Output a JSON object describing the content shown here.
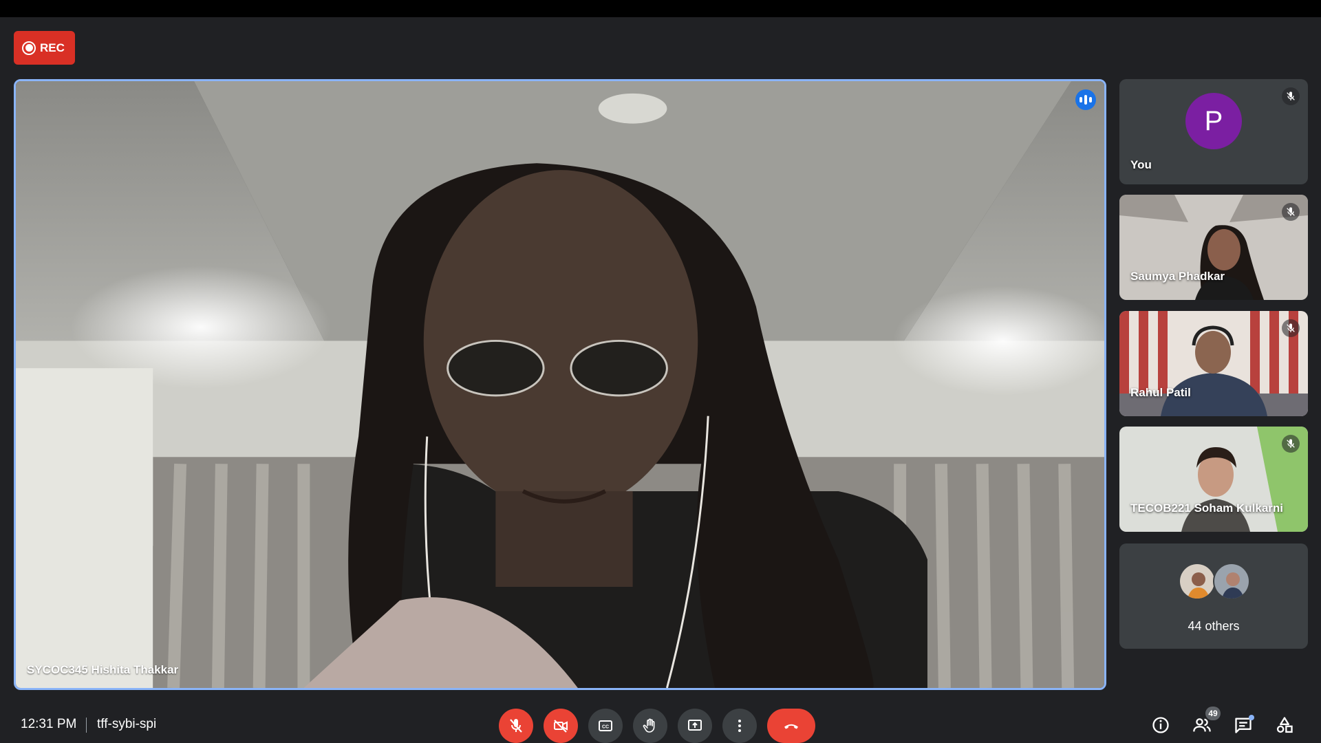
{
  "recording": {
    "label": "REC"
  },
  "main": {
    "participant_name": "SYCOC345 Hishita Thakkar",
    "speaking": true
  },
  "side_tiles": [
    {
      "name": "You",
      "avatar_letter": "P",
      "avatar_color": "#7b1fa2",
      "muted": true
    },
    {
      "name": "Saumya Phadkar",
      "muted": true
    },
    {
      "name": "Rahul Patil",
      "muted": true
    },
    {
      "name": "TECOB221 Soham Kulkarni",
      "muted": true
    }
  ],
  "others": {
    "label": "44 others"
  },
  "bottom": {
    "time": "12:31 PM",
    "meeting_code": "tff-sybi-spi",
    "controls": [
      "mic-off",
      "camera-off",
      "captions",
      "raise-hand",
      "present",
      "more-options",
      "leave-call"
    ],
    "people_count": "49",
    "right_icons": [
      "info",
      "people",
      "chat",
      "activities"
    ]
  },
  "colors": {
    "background": "#202124",
    "accent": "#8ab4f8",
    "danger": "#ea4335",
    "rec": "#d93025"
  }
}
